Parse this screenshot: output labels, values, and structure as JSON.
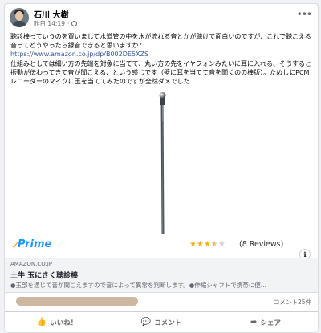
{
  "post": {
    "author": "石川 大樹",
    "time": "昨日 14:19",
    "privacy_icon": "globe-icon",
    "text_1": "聴診棒っていうのを買いまして水道管の中を水が流れる音とかが聴けて面白いのですが、これで聴こえる音ってどうやったら録音できると思いますか？",
    "link": "https://www.amazon.co.jp/dp/B002DE5XZS",
    "text_2": "仕組みとしては細い方の先端を対象に当てて、丸い方の先をイヤフォンみたいに耳に入れる、そうすると振動が伝わってきて音が聞こえる、という感じです（壁に耳を当てて音を聞くのの棒版）。ためしにPCMレコーダーのマイクに玉を当ててみたのですが全然ダメでした..."
  },
  "product": {
    "prime": "Prime",
    "rating": 3.5,
    "reviews": "(8 Reviews)"
  },
  "link_preview": {
    "domain": "AMAZON.CO.JP",
    "title": "土牛 玉にきく聴診棒",
    "description": "●玉部を通じて音が聞こえますので音によって異常を判断します。●伸縮シャフトで携帯に便..."
  },
  "reactions": {
    "comment_count": "コメント25件"
  },
  "actions": {
    "like": "いいね！",
    "comment": "コメント",
    "share": "シェア"
  },
  "colors": {
    "link": "#385898",
    "prime": "#1a98ff",
    "star": "#f2b01e"
  }
}
